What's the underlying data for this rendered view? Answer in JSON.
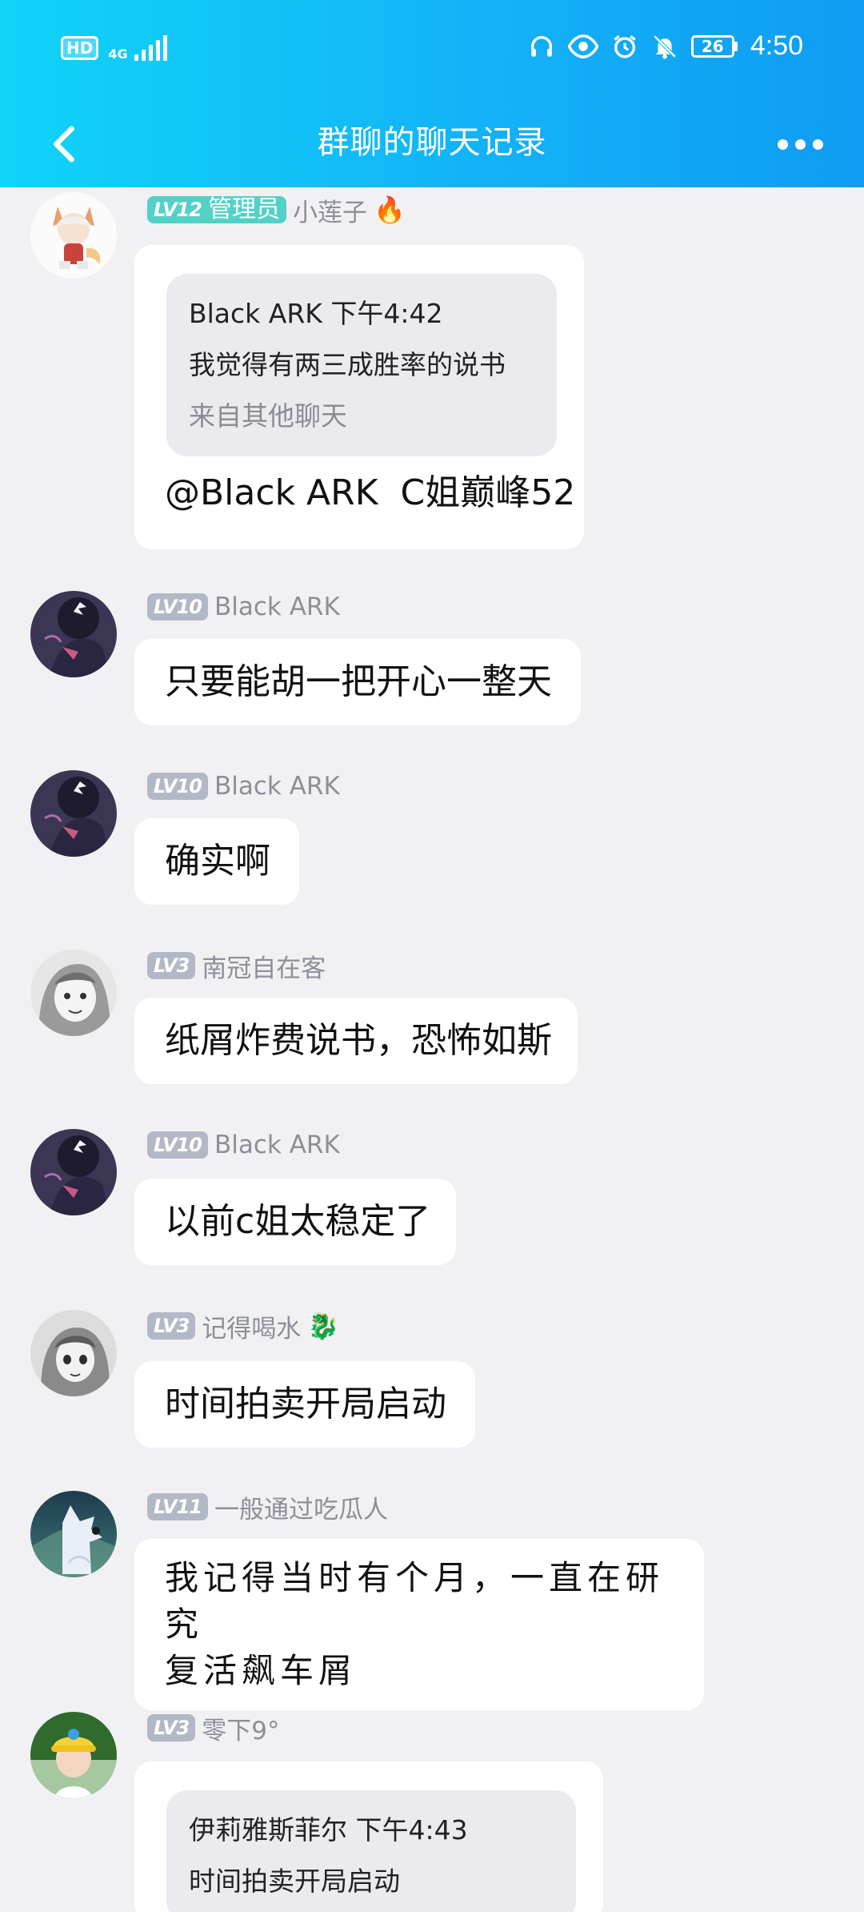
{
  "status_bar": {
    "hd": "HD",
    "network": "4G",
    "battery": "26",
    "time": "4:50"
  },
  "nav": {
    "title": "群聊的聊天记录"
  },
  "colors": {
    "header_start": "#10d4f8",
    "header_end": "#0f9cf2",
    "admin_badge": "#54d1c7",
    "level_badge": "#b3b8c6"
  },
  "messages": [
    {
      "level": "LV12",
      "role": "管理员",
      "name": "小莲子",
      "name_emoji": "🔥",
      "quote": {
        "header": "Black ARK 下午4:42",
        "text": "我觉得有两三成胜率的说书",
        "source": "来自其他聊天"
      },
      "text": "@Black ARK  C姐巅峰52"
    },
    {
      "level": "LV10",
      "name": "Black ARK",
      "text": "只要能胡一把开心一整天"
    },
    {
      "level": "LV10",
      "name": "Black ARK",
      "text": "确实啊"
    },
    {
      "level": "LV3",
      "name": "南冠自在客",
      "text": "纸屑炸费说书，恐怖如斯"
    },
    {
      "level": "LV10",
      "name": "Black ARK",
      "text": "以前c姐太稳定了"
    },
    {
      "level": "LV3",
      "name": "记得喝水",
      "name_emoji": "🐉",
      "text": "时间拍卖开局启动"
    },
    {
      "level": "LV11",
      "name": "一般通过吃瓜人",
      "text_line1": "我记得当时有个月，一直在研究",
      "text_line2": "复活飙车屑"
    },
    {
      "level": "LV3",
      "name": "零下9°",
      "quote": {
        "header": "伊莉雅斯菲尔 下午4:43",
        "text": "时间拍卖开局启动"
      }
    }
  ]
}
